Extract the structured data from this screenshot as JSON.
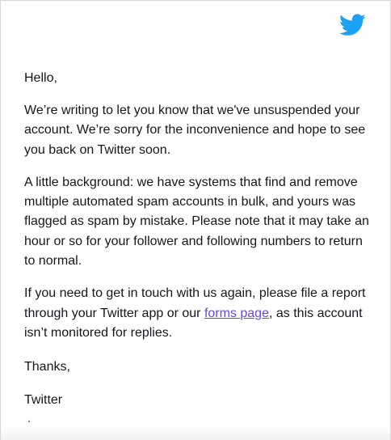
{
  "header": {
    "logo_icon": "twitter-bird-icon",
    "logo_color": "#1da1f2"
  },
  "email": {
    "greeting": "Hello,",
    "paragraph1": "We’re writing to let you know that we've unsuspended your account. We’re sorry for the inconvenience and hope to see you back on Twitter soon.",
    "paragraph2": "A little background: we have systems that find and remove multiple automated spam accounts in bulk, and yours was flagged as spam by mistake. Please note that it may take an hour or so for your follower and following numbers to return to normal.",
    "paragraph3_before_link": "If you need to get in touch with us again, please file a report through your Twitter app or our ",
    "forms_link_label": "forms page",
    "paragraph3_after_link": ", as this account isn’t monitored for replies.",
    "signoff": "Thanks,",
    "signature": "Twitter"
  },
  "colors": {
    "link": "#6b46e6",
    "text": "#14171a"
  }
}
